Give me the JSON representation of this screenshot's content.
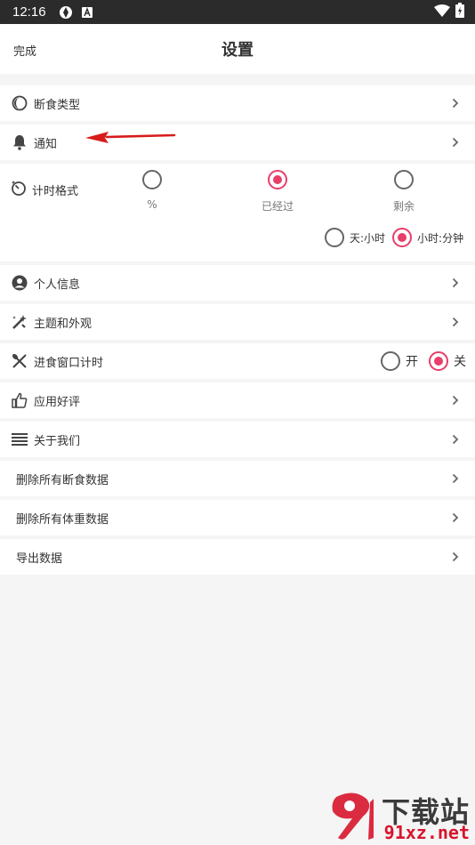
{
  "status": {
    "time": "12:16"
  },
  "header": {
    "done": "完成",
    "title": "设置"
  },
  "items": {
    "fasting_type": "断食类型",
    "notification": "通知",
    "timer_format": {
      "label": "计时格式",
      "options": [
        "%",
        "已经过",
        "剩余"
      ],
      "selected": "已经过",
      "sub_options": [
        "天:小时",
        "小时:分钟"
      ],
      "sub_selected": "小时:分钟"
    },
    "personal_info": "个人信息",
    "theme": "主题和外观",
    "eating_window": {
      "label": "进食窗口计时",
      "on": "开",
      "off": "关",
      "selected": "关"
    },
    "rate_app": "应用好评",
    "about": "关于我们",
    "delete_fasting": "删除所有断食数据",
    "delete_weight": "删除所有体重数据",
    "export": "导出数据"
  },
  "watermark": {
    "brand": "下载站",
    "site": "91xz.net"
  },
  "colors": {
    "accent": "#e83e6a",
    "arrow": "#d81b1b"
  }
}
